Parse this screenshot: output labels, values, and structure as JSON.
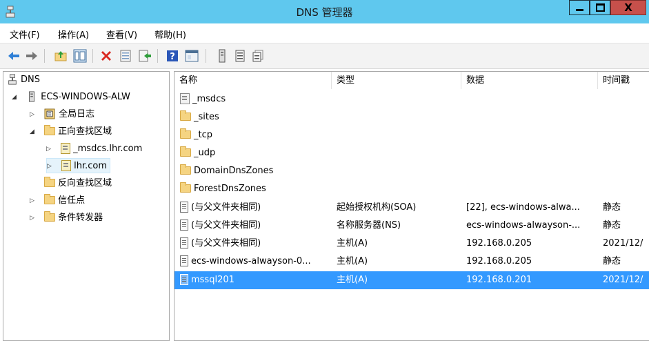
{
  "window": {
    "title": "DNS 管理器"
  },
  "menu": [
    "文件(F)",
    "操作(A)",
    "查看(V)",
    "帮助(H)"
  ],
  "toolbar": {
    "icons": [
      "back-icon",
      "forward-icon",
      "up-folder-icon",
      "show-hide-tree-icon",
      "delete-icon",
      "properties-icon",
      "export-icon",
      "help-icon",
      "console-icon",
      "server-icon",
      "list-icon",
      "records-icon"
    ]
  },
  "tree": {
    "root": "DNS",
    "server": "ECS-WINDOWS-ALW",
    "global_logs": "全局日志",
    "forward_zones": "正向查找区域",
    "zone_msdcs": "_msdcs.lhr.com",
    "zone_lhr": "lhr.com",
    "reverse_zones": "反向查找区域",
    "trust_points": "信任点",
    "conditional_forwarders": "条件转发器"
  },
  "list": {
    "columns": {
      "name": "名称",
      "type": "类型",
      "data": "数据",
      "timestamp": "时间戳"
    },
    "rows": [
      {
        "name": "_msdcs",
        "type": "",
        "data": "",
        "timestamp": ""
      },
      {
        "name": "_sites",
        "type": "",
        "data": "",
        "timestamp": ""
      },
      {
        "name": "_tcp",
        "type": "",
        "data": "",
        "timestamp": ""
      },
      {
        "name": "_udp",
        "type": "",
        "data": "",
        "timestamp": ""
      },
      {
        "name": "DomainDnsZones",
        "type": "",
        "data": "",
        "timestamp": ""
      },
      {
        "name": "ForestDnsZones",
        "type": "",
        "data": "",
        "timestamp": ""
      },
      {
        "name": "(与父文件夹相同)",
        "type": "起始授权机构(SOA)",
        "data": "[22], ecs-windows-alwa...",
        "timestamp": "静态"
      },
      {
        "name": "(与父文件夹相同)",
        "type": "名称服务器(NS)",
        "data": "ecs-windows-alwayson-...",
        "timestamp": "静态"
      },
      {
        "name": "(与父文件夹相同)",
        "type": "主机(A)",
        "data": "192.168.0.205",
        "timestamp": "2021/12/"
      },
      {
        "name": "ecs-windows-alwayson-0...",
        "type": "主机(A)",
        "data": "192.168.0.205",
        "timestamp": "静态"
      },
      {
        "name": "mssql201",
        "type": "主机(A)",
        "data": "192.168.0.201",
        "timestamp": "2021/12/"
      }
    ]
  },
  "colors": {
    "titlebar": "#5fc8ee",
    "selection": "#3399ff",
    "close_button": "#c7504b"
  }
}
